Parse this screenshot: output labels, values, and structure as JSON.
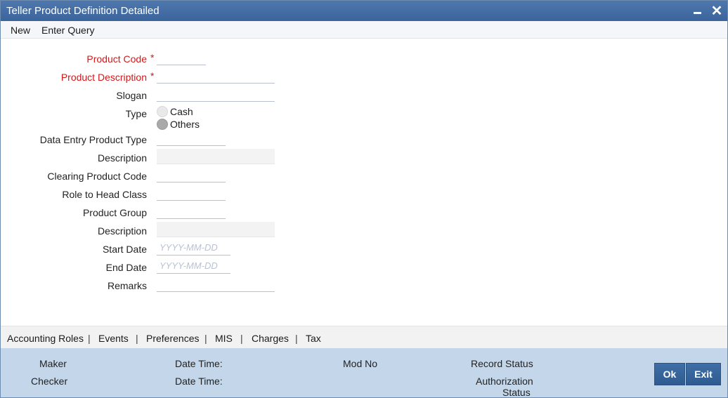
{
  "window": {
    "title": "Teller Product Definition Detailed",
    "minimize_symbol": "",
    "close_symbol": "✕"
  },
  "menu": {
    "new": "New",
    "enter_query": "Enter Query"
  },
  "form": {
    "product_code": {
      "label": "Product Code",
      "required": "*",
      "value": ""
    },
    "product_description": {
      "label": "Product Description",
      "required": "*",
      "value": ""
    },
    "slogan": {
      "label": "Slogan",
      "value": ""
    },
    "type": {
      "label": "Type",
      "options": [
        "Cash",
        "Others"
      ],
      "selected": "Others"
    },
    "data_entry_product_type": {
      "label": "Data Entry Product Type",
      "value": ""
    },
    "description1": {
      "label": "Description",
      "value": ""
    },
    "clearing_product_code": {
      "label": "Clearing Product Code",
      "value": ""
    },
    "role_to_head_class": {
      "label": "Role to Head Class",
      "value": ""
    },
    "product_group": {
      "label": "Product Group",
      "value": ""
    },
    "description2": {
      "label": "Description",
      "value": ""
    },
    "start_date": {
      "label": "Start Date",
      "placeholder": "YYYY-MM-DD",
      "value": ""
    },
    "end_date": {
      "label": "End Date",
      "placeholder": "YYYY-MM-DD",
      "value": ""
    },
    "remarks": {
      "label": "Remarks",
      "value": ""
    }
  },
  "tabs": [
    "Accounting Roles",
    "Events",
    "Preferences",
    "MIS",
    "Charges",
    "Tax"
  ],
  "tab_separator": "|",
  "footer": {
    "maker": "Maker",
    "checker": "Checker",
    "date_time_1": "Date Time:",
    "date_time_2": "Date Time:",
    "mod_no": "Mod No",
    "record_status": "Record Status",
    "authorization_status_line1": "Authorization",
    "authorization_status_line2": "Status",
    "ok_button": "Ok",
    "exit_button": "Exit"
  },
  "colors": {
    "title_bar": "#3f6ca3",
    "required_label": "#d0191a",
    "footer_bg": "#c4d7ea",
    "button": "#356398"
  }
}
